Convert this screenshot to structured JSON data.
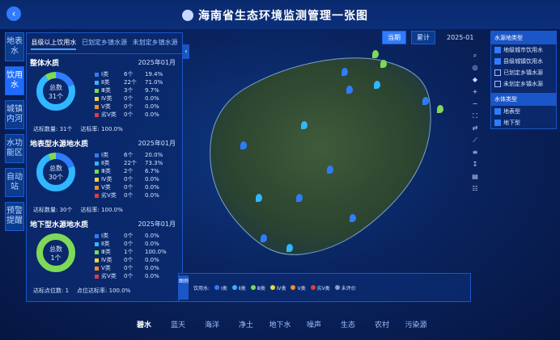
{
  "header": {
    "title": "海南省生态环境监测管理一张图"
  },
  "left_tabs": [
    {
      "label": "地表水",
      "active": false
    },
    {
      "label": "饮用水",
      "active": true
    },
    {
      "label": "城镇内河",
      "active": false
    },
    {
      "label": "水功能区",
      "active": false
    },
    {
      "label": "自动站",
      "active": false
    },
    {
      "label": "预警提醒",
      "active": false
    }
  ],
  "subtabs": [
    {
      "label": "县级以上饮用水",
      "active": true
    },
    {
      "label": "已划定乡镇水源",
      "active": false
    },
    {
      "label": "未划定乡镇水源",
      "active": false
    }
  ],
  "sections": [
    {
      "title": "整体水质",
      "date": "2025年01月",
      "center_label": "总数",
      "center_value": "31个",
      "rows": [
        {
          "name": "Ⅰ类",
          "count": "6个",
          "pct": "19.4%",
          "color": "#2f7cff"
        },
        {
          "name": "Ⅱ类",
          "count": "22个",
          "pct": "71.0%",
          "color": "#2fb7ff"
        },
        {
          "name": "Ⅲ类",
          "count": "3个",
          "pct": "9.7%",
          "color": "#7ed957"
        },
        {
          "name": "Ⅳ类",
          "count": "0个",
          "pct": "0.0%",
          "color": "#f5d33b"
        },
        {
          "name": "Ⅴ类",
          "count": "0个",
          "pct": "0.0%",
          "color": "#ff8a2b"
        },
        {
          "name": "劣Ⅴ类",
          "count": "0个",
          "pct": "0.0%",
          "color": "#e23c3c"
        }
      ],
      "footer": [
        "达标数量: 31个",
        "达标率: 100.0%"
      ],
      "fractions": [
        0.194,
        0.71,
        0.097,
        0,
        0,
        0
      ]
    },
    {
      "title": "地表型水源地水质",
      "date": "2025年01月",
      "center_label": "总数",
      "center_value": "30个",
      "rows": [
        {
          "name": "Ⅰ类",
          "count": "6个",
          "pct": "20.0%",
          "color": "#2f7cff"
        },
        {
          "name": "Ⅱ类",
          "count": "22个",
          "pct": "73.3%",
          "color": "#2fb7ff"
        },
        {
          "name": "Ⅲ类",
          "count": "2个",
          "pct": "6.7%",
          "color": "#7ed957"
        },
        {
          "name": "Ⅳ类",
          "count": "0个",
          "pct": "0.0%",
          "color": "#f5d33b"
        },
        {
          "name": "Ⅴ类",
          "count": "0个",
          "pct": "0.0%",
          "color": "#ff8a2b"
        },
        {
          "name": "劣Ⅴ类",
          "count": "0个",
          "pct": "0.0%",
          "color": "#e23c3c"
        }
      ],
      "footer": [
        "达标数量: 30个",
        "达标率: 100.0%"
      ],
      "fractions": [
        0.2,
        0.733,
        0.067,
        0,
        0,
        0
      ]
    },
    {
      "title": "地下型水源地水质",
      "date": "2025年01月",
      "center_label": "总数",
      "center_value": "1个",
      "rows": [
        {
          "name": "Ⅰ类",
          "count": "0个",
          "pct": "0.0%",
          "color": "#2f7cff"
        },
        {
          "name": "Ⅱ类",
          "count": "0个",
          "pct": "0.0%",
          "color": "#2fb7ff"
        },
        {
          "name": "Ⅲ类",
          "count": "1个",
          "pct": "100.0%",
          "color": "#7ed957"
        },
        {
          "name": "Ⅳ类",
          "count": "0个",
          "pct": "0.0%",
          "color": "#f5d33b"
        },
        {
          "name": "Ⅴ类",
          "count": "0个",
          "pct": "0.0%",
          "color": "#ff8a2b"
        },
        {
          "name": "劣Ⅴ类",
          "count": "0个",
          "pct": "0.0%",
          "color": "#e23c3c"
        }
      ],
      "footer": [
        "达标点位数: 1",
        "点位达标率: 100.0%"
      ],
      "fractions": [
        0,
        0,
        1,
        0,
        0,
        0
      ]
    }
  ],
  "map_controls": {
    "current": "当期",
    "cumulative": "累计",
    "date": "2025-01"
  },
  "right_panel": {
    "head1": "水源地类型",
    "types": [
      {
        "label": "地级城市饮用水",
        "checked": true
      },
      {
        "label": "县级城镇饮用水",
        "checked": true
      },
      {
        "label": "已划定乡镇水源",
        "checked": false
      },
      {
        "label": "未划定乡镇水源",
        "checked": false
      }
    ],
    "head2": "水体类型",
    "bodies": [
      {
        "label": "地表型",
        "checked": true
      },
      {
        "label": "地下型",
        "checked": true
      }
    ]
  },
  "legend_bar": {
    "tag": "图例",
    "title": "饮用水:",
    "items": [
      {
        "label": "Ⅰ类",
        "color": "#2f7cff"
      },
      {
        "label": "Ⅱ类",
        "color": "#2fb7ff"
      },
      {
        "label": "Ⅲ类",
        "color": "#7ed957"
      },
      {
        "label": "Ⅳ类",
        "color": "#f5d33b"
      },
      {
        "label": "Ⅴ类",
        "color": "#ff8a2b"
      },
      {
        "label": "劣Ⅴ类",
        "color": "#e23c3c"
      },
      {
        "label": "未评价",
        "color": "#8aa0c8"
      }
    ]
  },
  "bottom_nav": [
    {
      "label": "碧水",
      "active": true
    },
    {
      "label": "蓝天",
      "active": false
    },
    {
      "label": "海洋",
      "active": false
    },
    {
      "label": "净土",
      "active": false
    },
    {
      "label": "地下水",
      "active": false
    },
    {
      "label": "噪声",
      "active": false
    },
    {
      "label": "生态",
      "active": false
    },
    {
      "label": "农村",
      "active": false
    },
    {
      "label": "污染源",
      "active": false
    }
  ]
}
